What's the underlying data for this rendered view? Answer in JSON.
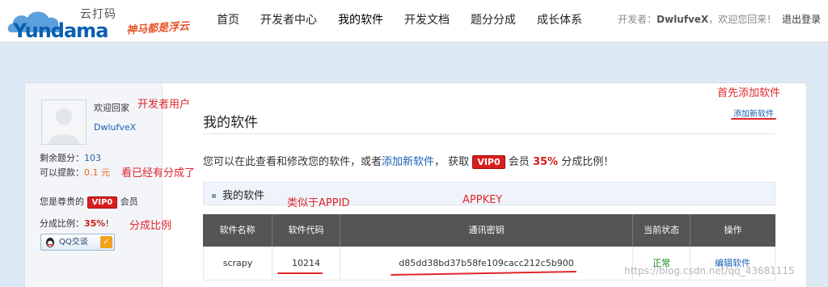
{
  "header": {
    "logo_cn": "云打码",
    "logo_en": "Yundama",
    "slogan": "神马都是浮云",
    "nav": [
      "首页",
      "开发者中心",
      "我的软件",
      "开发文档",
      "题分分成",
      "成长体系"
    ],
    "dev_prefix": "开发者：",
    "dev_name": "DwlufveX",
    "dev_suffix": "，欢迎您回来！",
    "logout": "退出登录"
  },
  "sidebar": {
    "welcome": "欢迎回家",
    "username": "DwlufveX",
    "remaining_label": "剩余题分：",
    "remaining_value": "103",
    "withdraw_label": "可以提款：",
    "withdraw_value": "0.1 元",
    "vip_prefix": "您是尊贵的",
    "vip_badge": "VIP0",
    "vip_suffix": "会员",
    "share_label": "分成比例：",
    "share_value": "35%",
    "share_suffix": "!",
    "qq_label": "QQ交谈"
  },
  "main": {
    "title": "我的软件",
    "add_link": "添加新软件",
    "intro_1": "您可以在此查看和修改您的软件，或者",
    "intro_link": "添加新软件",
    "intro_2": "，  获取",
    "intro_vip": "VIP0",
    "intro_3": "会员",
    "intro_pct": "35%",
    "intro_4": "分成比例！",
    "section_title": "我的软件"
  },
  "table": {
    "headers": [
      "软件名称",
      "软件代码",
      "通讯密钥",
      "当前状态",
      "操作"
    ],
    "rows": [
      {
        "name": "scrapy",
        "code": "10214",
        "key": "d85dd38bd37b58fe109cacc212c5b900",
        "status": "正常",
        "action": "编辑软件"
      }
    ]
  },
  "annotations": {
    "dev_user": "开发者用户",
    "already_share": "看已经有分成了",
    "share_ratio": "分成比例",
    "add_first": "首先添加软件",
    "appid_like": "类似于APPID",
    "appkey": "APPKEY"
  },
  "watermark": "https://blog.csdn.net/qq_43681115",
  "colors": {
    "accent_blue": "#1a5fb5",
    "annotation_red": "#e0262b",
    "vip_red": "#d81e1e",
    "table_header": "#555555",
    "status_green": "#1a8a1a"
  },
  "icons": {
    "qq": "qq-penguin-icon",
    "check": "check-icon",
    "avatar": "avatar-placeholder-icon",
    "logo": "cloud-logo-icon"
  }
}
